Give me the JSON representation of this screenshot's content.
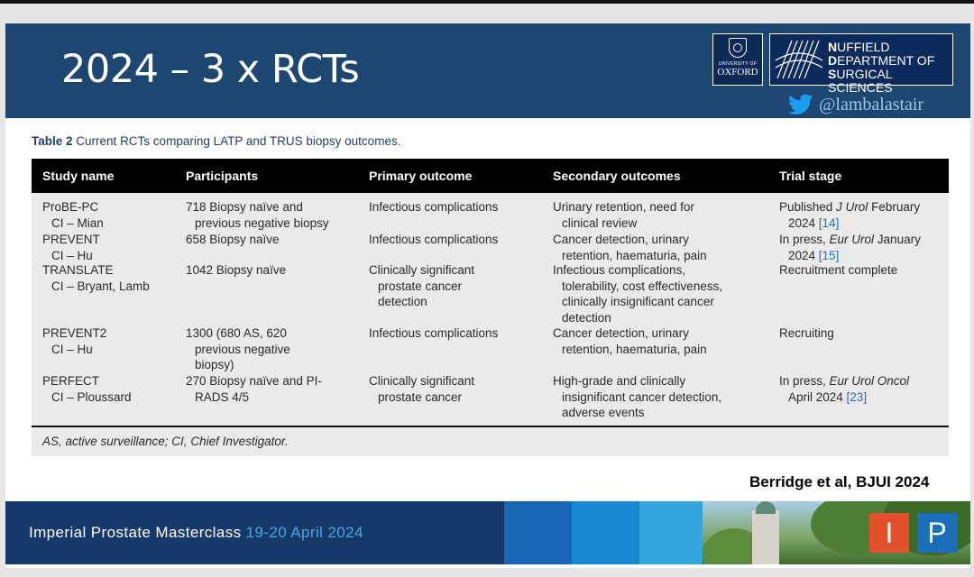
{
  "slide": {
    "title": "2024 – 3 x RCTs",
    "oxford_line1": "UNIVERSITY OF",
    "oxford_line2": "OXFORD",
    "ndss": [
      {
        "initial": "N",
        "rest": "UFFIELD"
      },
      {
        "initial": "D",
        "rest": "EPARTMENT OF"
      },
      {
        "initial": "S",
        "rest": "URGICAL SCIENCES"
      }
    ],
    "twitter_handle": "@lambalastair",
    "citation": "Berridge et al, BJUI 2024"
  },
  "table": {
    "caption_label": "Table 2",
    "caption_text": "Current RCTs comparing LATP and TRUS biopsy outcomes.",
    "headers": [
      "Study name",
      "Participants",
      "Primary outcome",
      "Secondary outcomes",
      "Trial stage"
    ],
    "rows": [
      {
        "study": [
          "ProBE-PC",
          "CI – Mian"
        ],
        "participants": [
          "718 Biopsy naïve and",
          "previous negative biopsy"
        ],
        "primary": [
          "Infectious complications"
        ],
        "secondary": [
          "Urinary retention, need for",
          "clinical review"
        ],
        "stage_pre": "Published ",
        "stage_journal": "J Urol",
        "stage_post": " February",
        "stage_line2": "2024 ",
        "stage_ref": "[14]"
      },
      {
        "study": [
          "PREVENT",
          "CI – Hu"
        ],
        "participants": [
          "658 Biopsy naïve"
        ],
        "primary": [
          "Infectious complications"
        ],
        "secondary": [
          "Cancer detection, urinary",
          "retention, haematuria, pain"
        ],
        "stage_pre": "In press, ",
        "stage_journal": "Eur Urol",
        "stage_post": " January",
        "stage_line2": "2024 ",
        "stage_ref": "[15]"
      },
      {
        "study": [
          "TRANSLATE",
          "CI – Bryant, Lamb"
        ],
        "participants": [
          "1042 Biopsy naïve"
        ],
        "primary": [
          "Clinically significant",
          "prostate cancer",
          "detection"
        ],
        "secondary": [
          "Infectious complications,",
          "tolerability, cost effectiveness,",
          "clinically insignificant cancer",
          "detection"
        ],
        "stage_text": "Recruitment complete"
      },
      {
        "study": [
          "PREVENT2",
          "CI – Hu"
        ],
        "participants": [
          "1300 (680 AS, 620",
          "previous negative",
          "biopsy)"
        ],
        "primary": [
          "Infectious complications"
        ],
        "secondary": [
          "Cancer detection, urinary",
          "retention, haematuria, pain"
        ],
        "stage_text": "Recruiting"
      },
      {
        "study": [
          "PERFECT",
          "CI – Ploussard"
        ],
        "participants": [
          "270 Biopsy naïve and PI-",
          "RADS 4/5"
        ],
        "primary": [
          "Clinically significant",
          "prostate cancer"
        ],
        "secondary": [
          "High-grade and clinically",
          "insignificant cancer detection,",
          "adverse events"
        ],
        "stage_pre": "In press, ",
        "stage_journal": "Eur Urol Oncol",
        "stage_post": "",
        "stage_line2": "April 2024 ",
        "stage_ref": "[23]"
      }
    ],
    "footnote": "AS, active surveillance; CI, Chief Investigator."
  },
  "footer": {
    "text": "Imperial Prostate Masterclass",
    "date": "19-20 April 2024",
    "logo_i": "I",
    "logo_p": "P"
  },
  "colors": {
    "header_bg": "#1d4670",
    "footer_bg": "#15396a",
    "link_blue": "#2a6fb5",
    "logo_red": "#e2502c",
    "logo_blue": "#1a6fb8"
  }
}
